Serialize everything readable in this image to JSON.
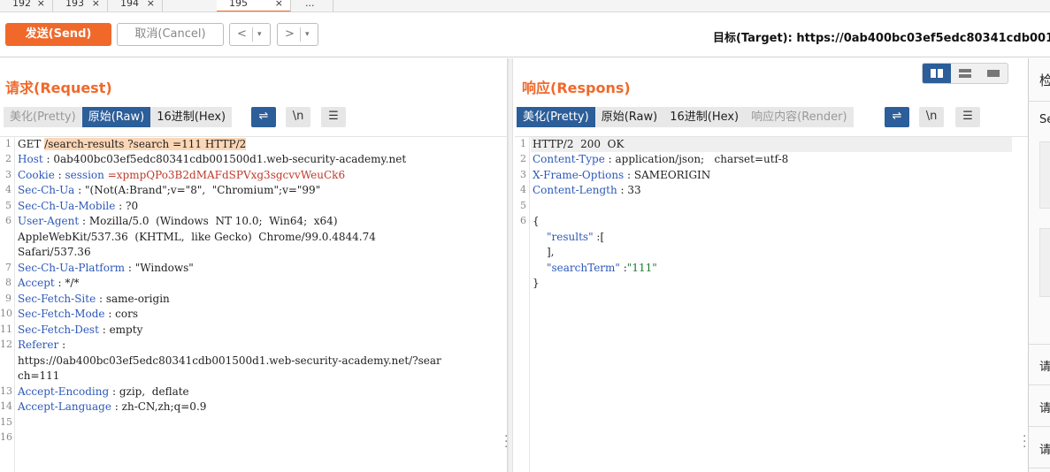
{
  "tabs": [
    {
      "label": "192",
      "close": "×"
    },
    {
      "label": "193",
      "close": "×"
    },
    {
      "label": "194",
      "close": "×"
    },
    {
      "label": "195",
      "close": "×"
    },
    {
      "label": "..."
    }
  ],
  "toolbar": {
    "send_label": "发送(Send)",
    "cancel_label": "取消(Cancel)",
    "back_arrow": "<",
    "forward_arrow": ">",
    "dropdown": "▾",
    "target_label": "目标(Target): https://0ab400bc03ef5edc80341cdb0015"
  },
  "request": {
    "title": "请求(Request)",
    "view_tabs": [
      "美化(Pretty)",
      "原始(Raw)",
      "16进制(Hex)"
    ],
    "icons": {
      "wrap": "⇌",
      "newline": "\\n",
      "menu": "☰"
    },
    "line_numbers": [
      "1",
      "2",
      "3",
      "4",
      "5",
      "6",
      "",
      "",
      "7",
      "8",
      "9",
      "10",
      "11",
      "12",
      "",
      "",
      "13",
      "14",
      "15",
      "16"
    ],
    "lines": {
      "l1_method": "GET ",
      "l1_path": "/search-results ?search =111 HTTP/2",
      "l2_key": "Host",
      "l2_val": " : 0ab400bc03ef5edc80341cdb001500d1.web-security-academy.net",
      "l3_key": "Cookie",
      "l3_sep": " : ",
      "l3_ck": "session",
      "l3_val": " =xpmpQPo3B2dMAFdSPVxg3sgcvvWeuCk6",
      "l4_key": "Sec-Ch-Ua",
      "l4_val": " : \"(Not(A:Brand\";v=\"8\",  \"Chromium\";v=\"99\"",
      "l5_key": "Sec-Ch-Ua-Mobile",
      "l5_val": " : ?0",
      "l6_key": "User-Agent",
      "l6_val": " : Mozilla/5.0  (Windows  NT 10.0;  Win64;  x64)",
      "l6_c1": "AppleWebKit/537.36  (KHTML,  like Gecko)  Chrome/99.0.4844.74",
      "l6_c2": "Safari/537.36",
      "l7_key": "Sec-Ch-Ua-Platform",
      "l7_val": " : \"Windows\"",
      "l8_key": "Accept",
      "l8_val": " : */*",
      "l9_key": "Sec-Fetch-Site",
      "l9_val": " : same-origin",
      "l10_key": "Sec-Fetch-Mode",
      "l10_val": " : cors",
      "l11_key": "Sec-Fetch-Dest",
      "l11_val": " : empty",
      "l12_key": "Referer",
      "l12_val": " :",
      "l12_c1": "https://0ab400bc03ef5edc80341cdb001500d1.web-security-academy.net/?sear",
      "l12_c2": "ch=111",
      "l13_key": "Accept-Encoding",
      "l13_val": " : gzip,  deflate",
      "l14_key": "Accept-Language",
      "l14_val": " : zh-CN,zh;q=0.9"
    }
  },
  "response": {
    "title": "响应(Respons)",
    "view_tabs": [
      "美化(Pretty)",
      "原始(Raw)",
      "16进制(Hex)",
      "响应内容(Render)"
    ],
    "icons": {
      "wrap": "⇌",
      "newline": "\\n",
      "menu": "☰"
    },
    "line_numbers": [
      "1",
      "2",
      "3",
      "4",
      "5",
      "6"
    ],
    "lines": {
      "l1": "HTTP/2  200  OK",
      "l2_key": "Content-Type",
      "l2_val": " : application/json;   charset=utf-8",
      "l3_key": "X-Frame-Options",
      "l3_val": " : SAMEORIGIN",
      "l4_key": "Content-Length",
      "l4_val": " : 33",
      "j1": "{",
      "j2_key": "\"results\"",
      "j2_rest": " :[",
      "j3": "],",
      "j4_key": "\"searchTerm\"",
      "j4_sep": " :",
      "j4_val": "\"111\"",
      "j5": "}"
    }
  },
  "sidebar": {
    "heading": "检",
    "item_se": "Se",
    "items": [
      "请",
      "请",
      "请"
    ]
  }
}
